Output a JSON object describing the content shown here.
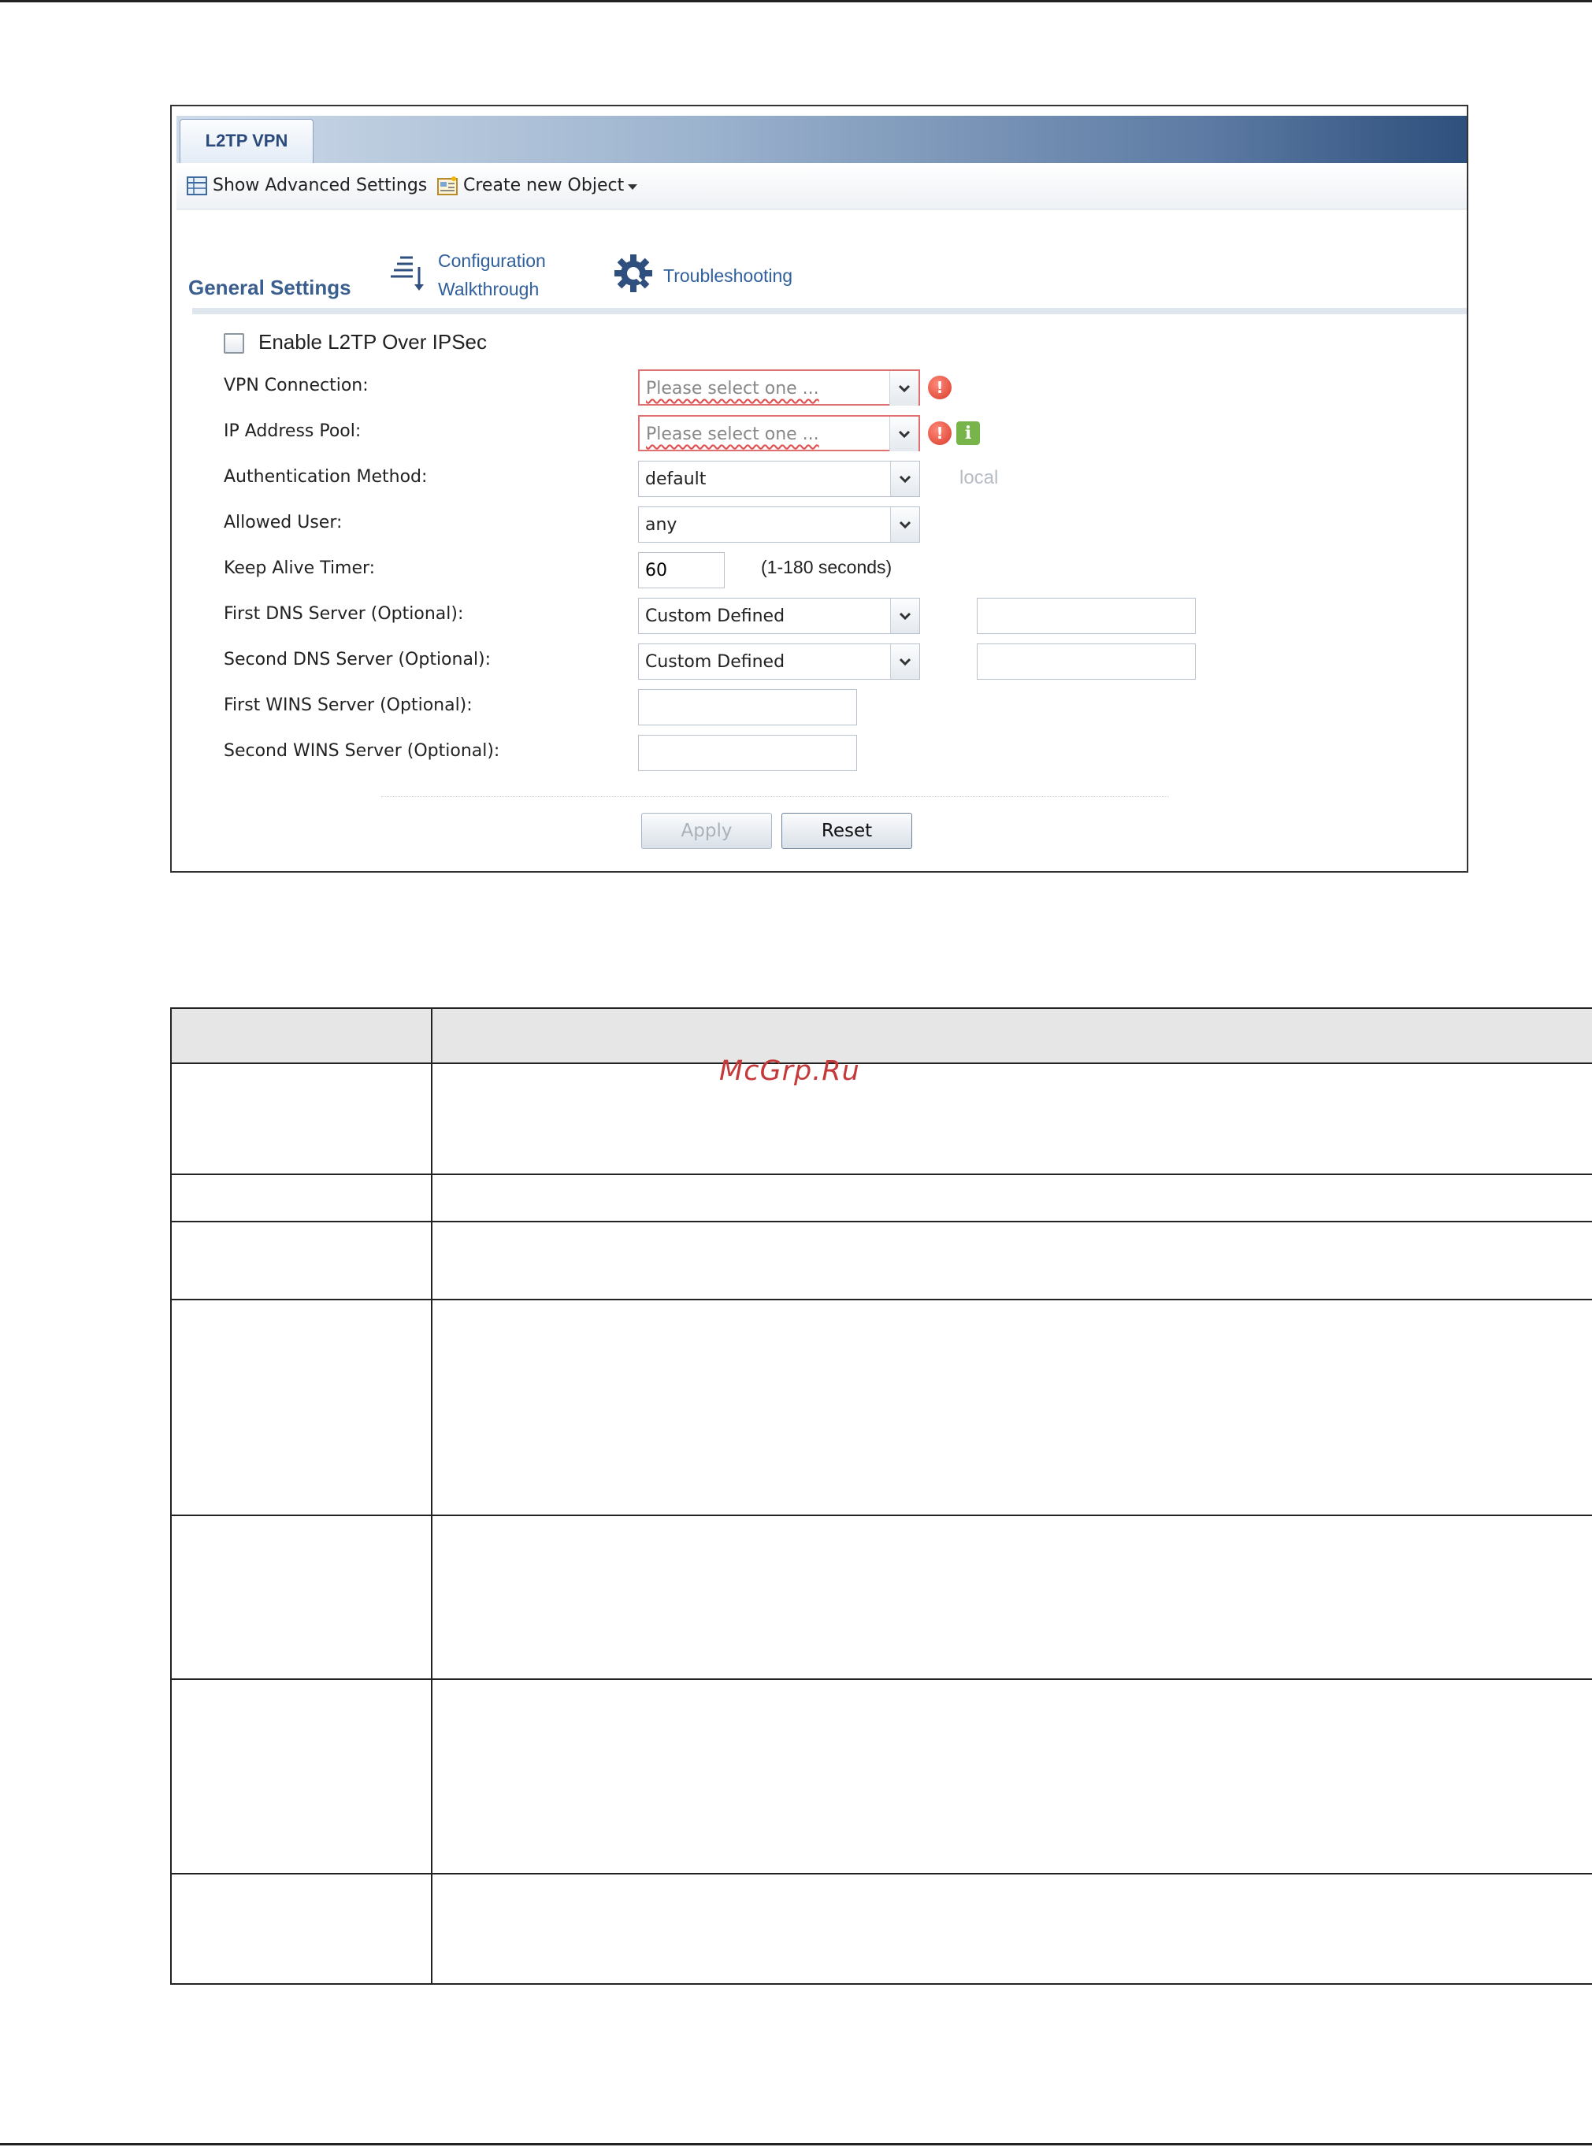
{
  "tab": {
    "label": "L2TP VPN"
  },
  "toolbar": {
    "show_advanced": "Show Advanced Settings",
    "create_object": "Create new Object"
  },
  "section": {
    "title": "General Settings",
    "config_walkthrough_line1": "Configuration",
    "config_walkthrough_line2": "Walkthrough",
    "troubleshooting": "Troubleshooting"
  },
  "form": {
    "enable_label": "Enable L2TP Over IPSec",
    "enable_checked": false,
    "vpn_connection": {
      "label": "VPN Connection:",
      "value": "Please select one ..."
    },
    "ip_address_pool": {
      "label": "IP Address Pool:",
      "value": "Please select one ..."
    },
    "auth_method": {
      "label": "Authentication Method:",
      "value": "default",
      "note": "local"
    },
    "allowed_user": {
      "label": "Allowed User:",
      "value": "any"
    },
    "keep_alive": {
      "label": "Keep Alive Timer:",
      "value": "60",
      "hint": "(1-180 seconds)"
    },
    "first_dns": {
      "label": "First DNS Server (Optional):",
      "value": "Custom Defined",
      "ip": ""
    },
    "second_dns": {
      "label": "Second DNS Server (Optional):",
      "value": "Custom Defined",
      "ip": ""
    },
    "first_wins": {
      "label": "First WINS Server (Optional):",
      "value": ""
    },
    "second_wins": {
      "label": "Second WINS Server (Optional):",
      "value": ""
    }
  },
  "buttons": {
    "apply": "Apply",
    "reset": "Reset"
  },
  "watermark": "McGrp.Ru",
  "colors": {
    "accent": "#3a5f8f",
    "error": "#d83a2a",
    "info": "#77b54a"
  }
}
